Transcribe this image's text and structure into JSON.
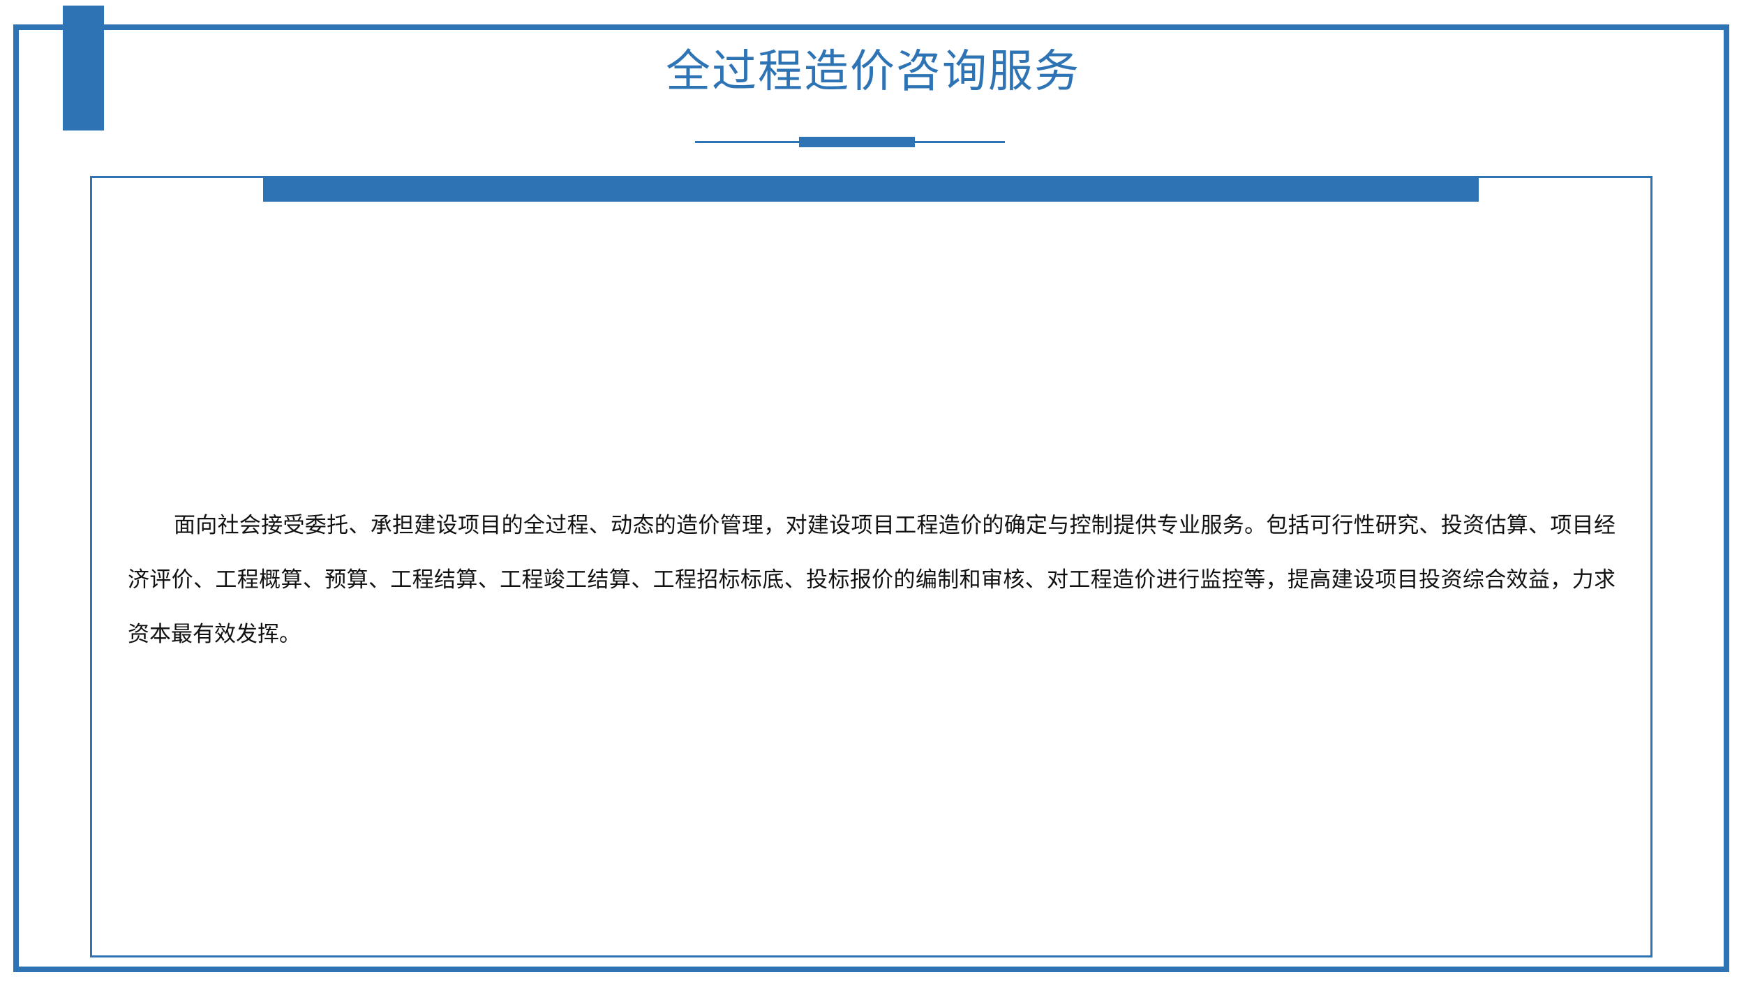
{
  "slide": {
    "title": "全过程造价咨询服务",
    "body": "面向社会接受委托、承担建设项目的全过程、动态的造价管理，对建设项目工程造价的确定与控制提供专业服务。包括可行性研究、投资估算、项目经济评价、工程概算、预算、工程结算、工程竣工结算、工程招标标底、投标报价的编制和审核、对工程造价进行监控等，提高建设项目投资综合效益，力求资本最有效发挥。"
  },
  "colors": {
    "accent": "#2e74b5",
    "text": "#111111",
    "background": "#ffffff"
  }
}
